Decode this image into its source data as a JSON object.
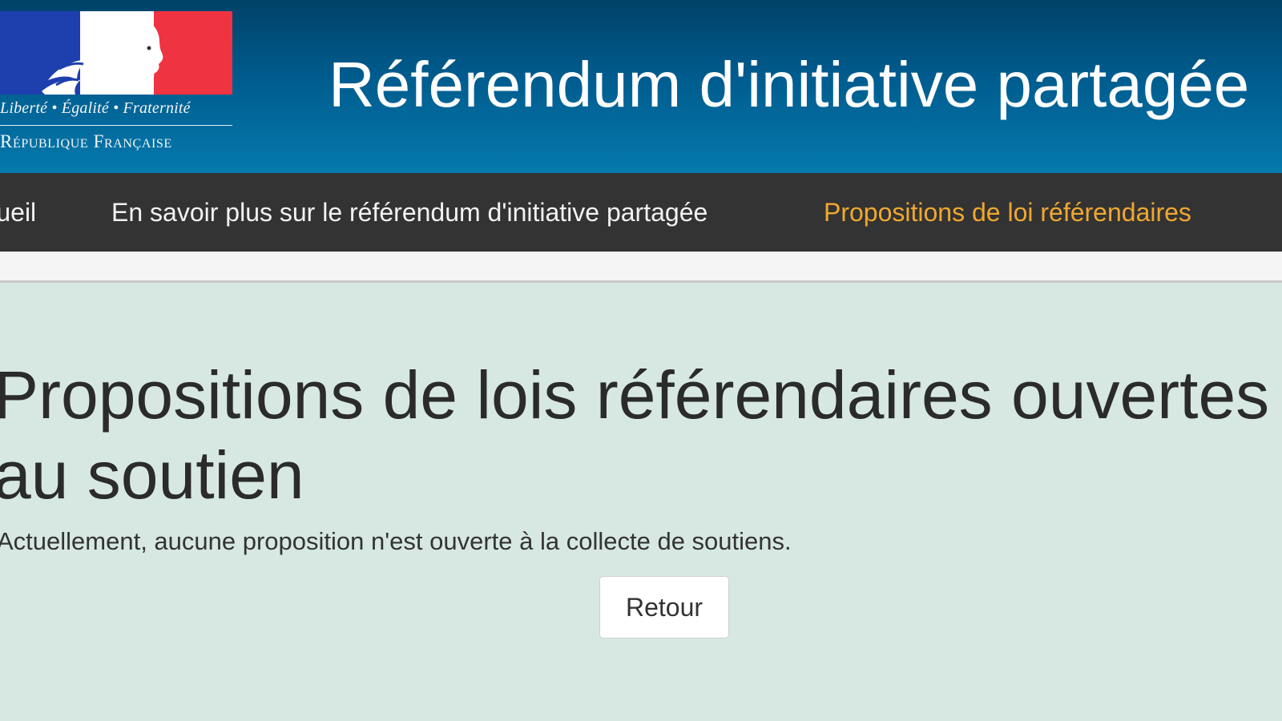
{
  "header": {
    "motto": "Liberté • Égalité • Fraternité",
    "republic": "République Française",
    "site_title": "Référendum d'initiative partagée",
    "logo_icon": "marianne-logo-icon",
    "colors": {
      "flag_blue": "#1e3fae",
      "flag_red": "#ef3340",
      "band_top": "#004268",
      "band_bottom": "#0579ad"
    }
  },
  "nav": {
    "items": [
      {
        "label": "Accueil"
      },
      {
        "label": "En savoir plus sur le référendum d'initiative partagée"
      },
      {
        "label": "Propositions de loi référendaires"
      }
    ],
    "active_color": "#f0a830"
  },
  "main": {
    "title": "Propositions de lois référendaires ouvertes\nau soutien",
    "notice": "Actuellement, aucune proposition n'est ouverte à la collecte de soutiens.",
    "back_button": "Retour"
  }
}
